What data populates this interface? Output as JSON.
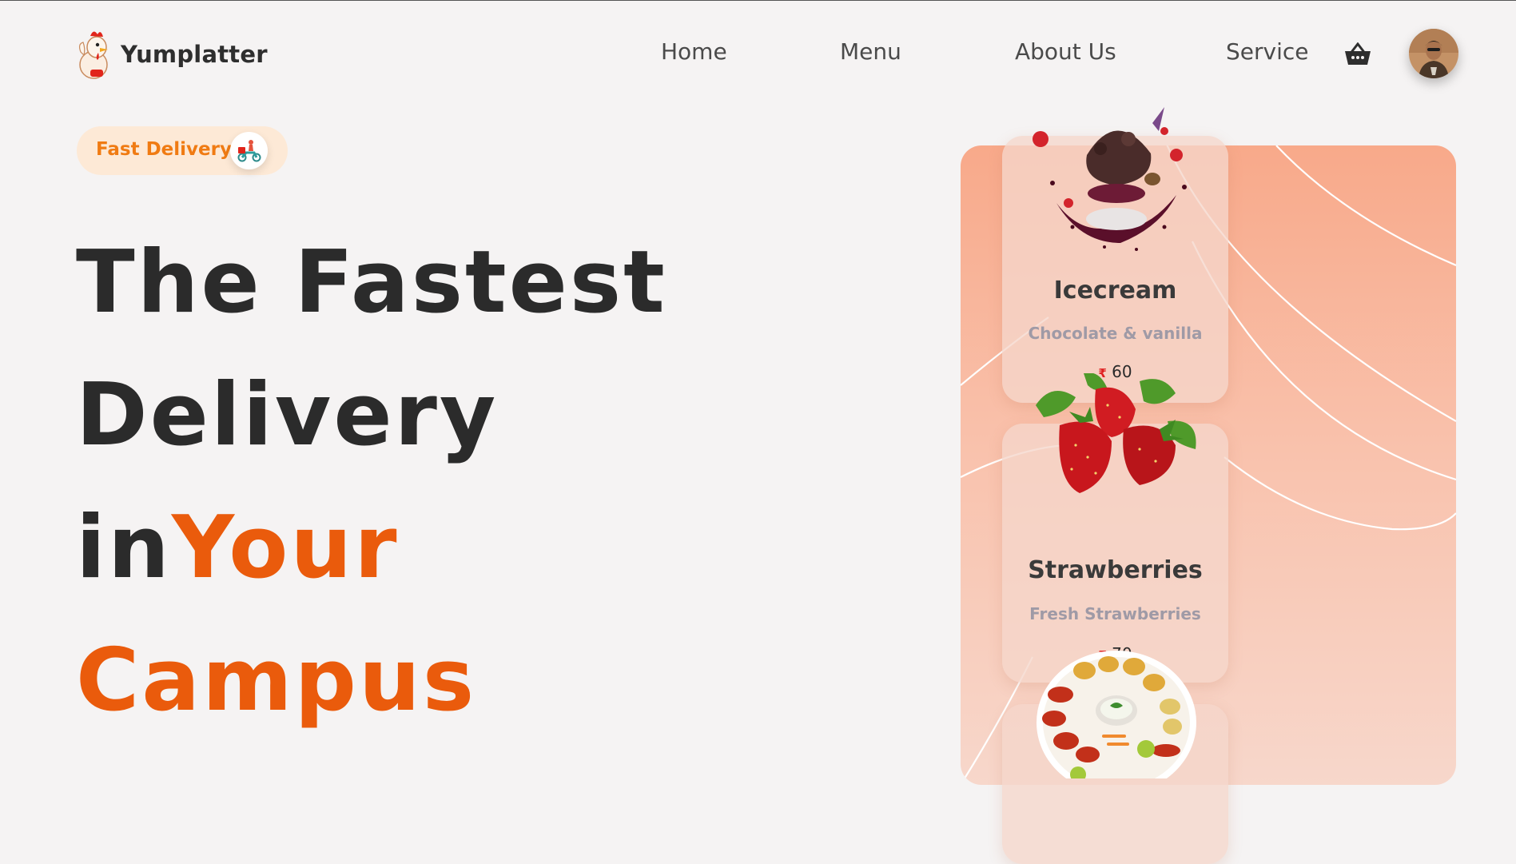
{
  "brand": {
    "name": "Yumplatter",
    "logo_icon": "chicken-mascot-icon"
  },
  "nav": {
    "items": [
      {
        "label": "Home"
      },
      {
        "label": "Menu"
      },
      {
        "label": "About Us"
      },
      {
        "label": "Service"
      }
    ],
    "cart_icon": "basket-icon",
    "avatar_icon": "user-avatar"
  },
  "hero": {
    "badge_label": "Fast Delivery",
    "badge_icon": "scooter-delivery-icon",
    "title_line1": "The Fastest",
    "title_line2": "Delivery",
    "title_line3_prefix": "in",
    "title_line3_accent": "Your",
    "title_line4_accent": "Campus"
  },
  "cards": [
    {
      "title": "Icecream",
      "subtitle": "Chocolate & vanilla",
      "currency": "₹",
      "price": "60",
      "image_icon": "chocolate-icecream-image"
    },
    {
      "title": "Strawberries",
      "subtitle": "Fresh Strawberries",
      "currency": "₹",
      "price": "70",
      "image_icon": "strawberries-image"
    },
    {
      "title": "",
      "subtitle": "",
      "currency": "",
      "price": "",
      "image_icon": "tandoori-platter-image"
    }
  ],
  "colors": {
    "accent": "#ea5b0c",
    "badge_text": "#f07b13",
    "badge_bg": "#fde9d6",
    "heading": "#2b2b2b",
    "panel_top": "#f8a98a",
    "panel_bottom": "#f7d7cb"
  }
}
